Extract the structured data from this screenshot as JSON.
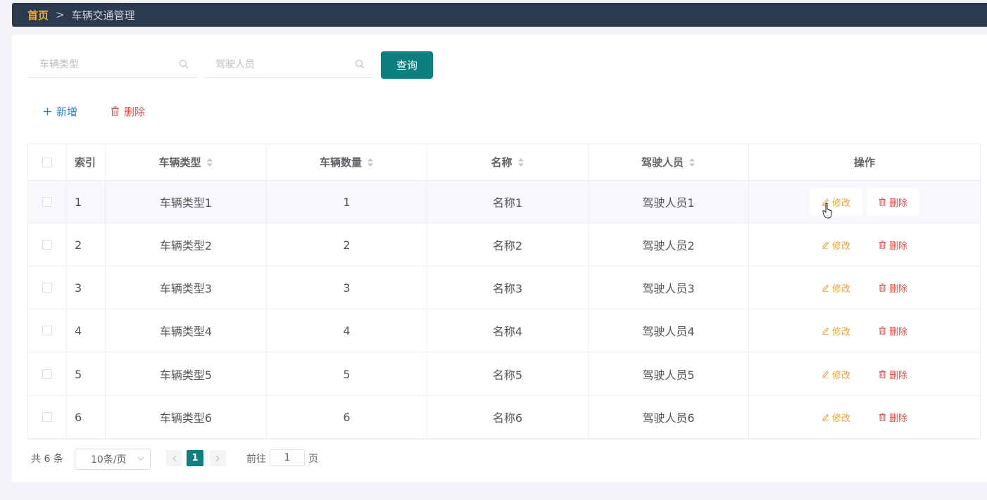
{
  "breadcrumb": {
    "home": "首页",
    "separator": ">",
    "current": "车辆交通管理"
  },
  "search": {
    "vehicle_type_placeholder": "车辆类型",
    "driver_placeholder": "驾驶人员",
    "query_label": "查询"
  },
  "actions": {
    "add_label": "新增",
    "delete_label": "删除"
  },
  "table": {
    "headers": {
      "index": "索引",
      "vehicle_type": "车辆类型",
      "vehicle_count": "车辆数量",
      "name": "名称",
      "driver": "驾驶人员",
      "operation": "操作"
    },
    "row_actions": {
      "edit": "修改",
      "delete": "删除"
    },
    "rows": [
      {
        "index": "1",
        "vehicle_type": "车辆类型1",
        "vehicle_count": "1",
        "name": "名称1",
        "driver": "驾驶人员1"
      },
      {
        "index": "2",
        "vehicle_type": "车辆类型2",
        "vehicle_count": "2",
        "name": "名称2",
        "driver": "驾驶人员2"
      },
      {
        "index": "3",
        "vehicle_type": "车辆类型3",
        "vehicle_count": "3",
        "name": "名称3",
        "driver": "驾驶人员3"
      },
      {
        "index": "4",
        "vehicle_type": "车辆类型4",
        "vehicle_count": "4",
        "name": "名称4",
        "driver": "驾驶人员4"
      },
      {
        "index": "5",
        "vehicle_type": "车辆类型5",
        "vehicle_count": "5",
        "name": "名称5",
        "driver": "驾驶人员5"
      },
      {
        "index": "6",
        "vehicle_type": "车辆类型6",
        "vehicle_count": "6",
        "name": "名称6",
        "driver": "驾驶人员6"
      }
    ]
  },
  "pagination": {
    "total_text": "共 6 条",
    "page_size": "10条/页",
    "current_page": "1",
    "goto_label": "前往",
    "goto_value": "1",
    "goto_suffix": "页"
  },
  "colors": {
    "topbar": "#2b3a4d",
    "accent": "#0c7f80",
    "home_crumb": "#f2a93b",
    "edit": "#e8a33b",
    "delete": "#d9534f",
    "add": "#2f7fc9"
  }
}
